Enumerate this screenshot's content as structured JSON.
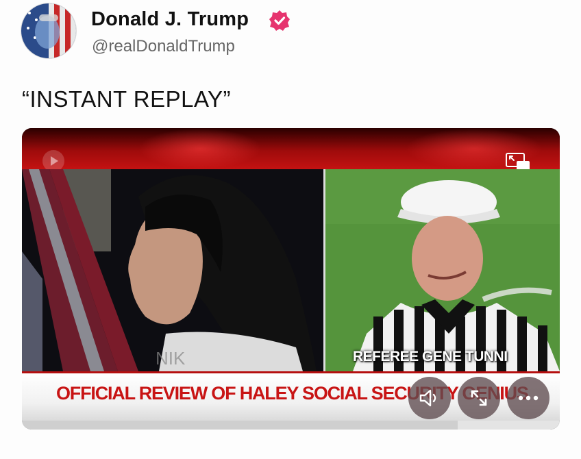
{
  "post": {
    "author_name": "Donald J. Trump",
    "handle": "@realDonaldTrump",
    "text": "“INSTANT REPLAY”"
  },
  "video": {
    "caption": "REFEREE GENE TUNNI",
    "lower_third": "OFFICIAL REVIEW OF HALEY SOCIAL SECURITY GENIUS",
    "progress": 0.81,
    "icons": [
      "play-badge-icon",
      "picture-in-picture-icon",
      "volume-icon",
      "expand-icon",
      "more-options-icon"
    ]
  },
  "colors": {
    "verified": "#e6346e",
    "lower_third_text": "#c81414",
    "banner_red": "#b50f0f"
  }
}
